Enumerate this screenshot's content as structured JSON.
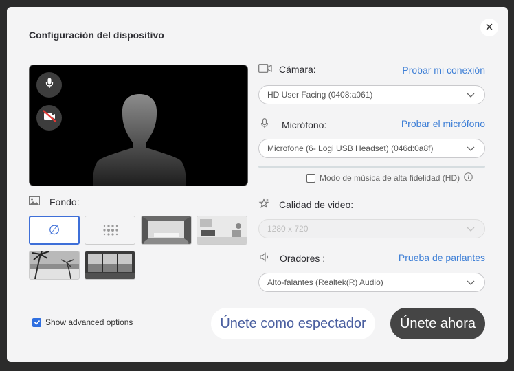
{
  "dialog": {
    "title": "Configuración del dispositivo",
    "close_label": "×"
  },
  "preview": {
    "mic_icon": "microphone-icon",
    "camera_off_icon": "camera-off-icon",
    "silhouette": "person-silhouette"
  },
  "background": {
    "label": "Fondo:",
    "none_symbol": "∅",
    "tiles": [
      "none",
      "blur",
      "room-1",
      "room-2",
      "beach",
      "window"
    ]
  },
  "camera": {
    "label": "Cámara:",
    "link": "Probar mi conexión",
    "value": "HD User Facing (0408:a061)"
  },
  "microphone": {
    "label": "Micrófono:",
    "link": "Probar el micrófono",
    "value": "Microfone (6- Logi USB Headset) (046d:0a8f)",
    "hd_label": "Modo de música de alta fidelidad (HD)",
    "hd_checked": false
  },
  "video_quality": {
    "label": "Calidad de video:",
    "value": "1280 x 720",
    "disabled": true
  },
  "speakers": {
    "label": "Oradores :",
    "link": "Prueba de parlantes",
    "value": "Alto-falantes (Realtek(R) Audio)"
  },
  "footer": {
    "advanced_label": "Show advanced options",
    "advanced_checked": true,
    "spectator_button": "Únete como espectador",
    "join_button": "Únete ahora"
  },
  "colors": {
    "accent": "#3e7fd6",
    "dark_button": "#454545",
    "dialog_bg": "#f4f4f5"
  }
}
